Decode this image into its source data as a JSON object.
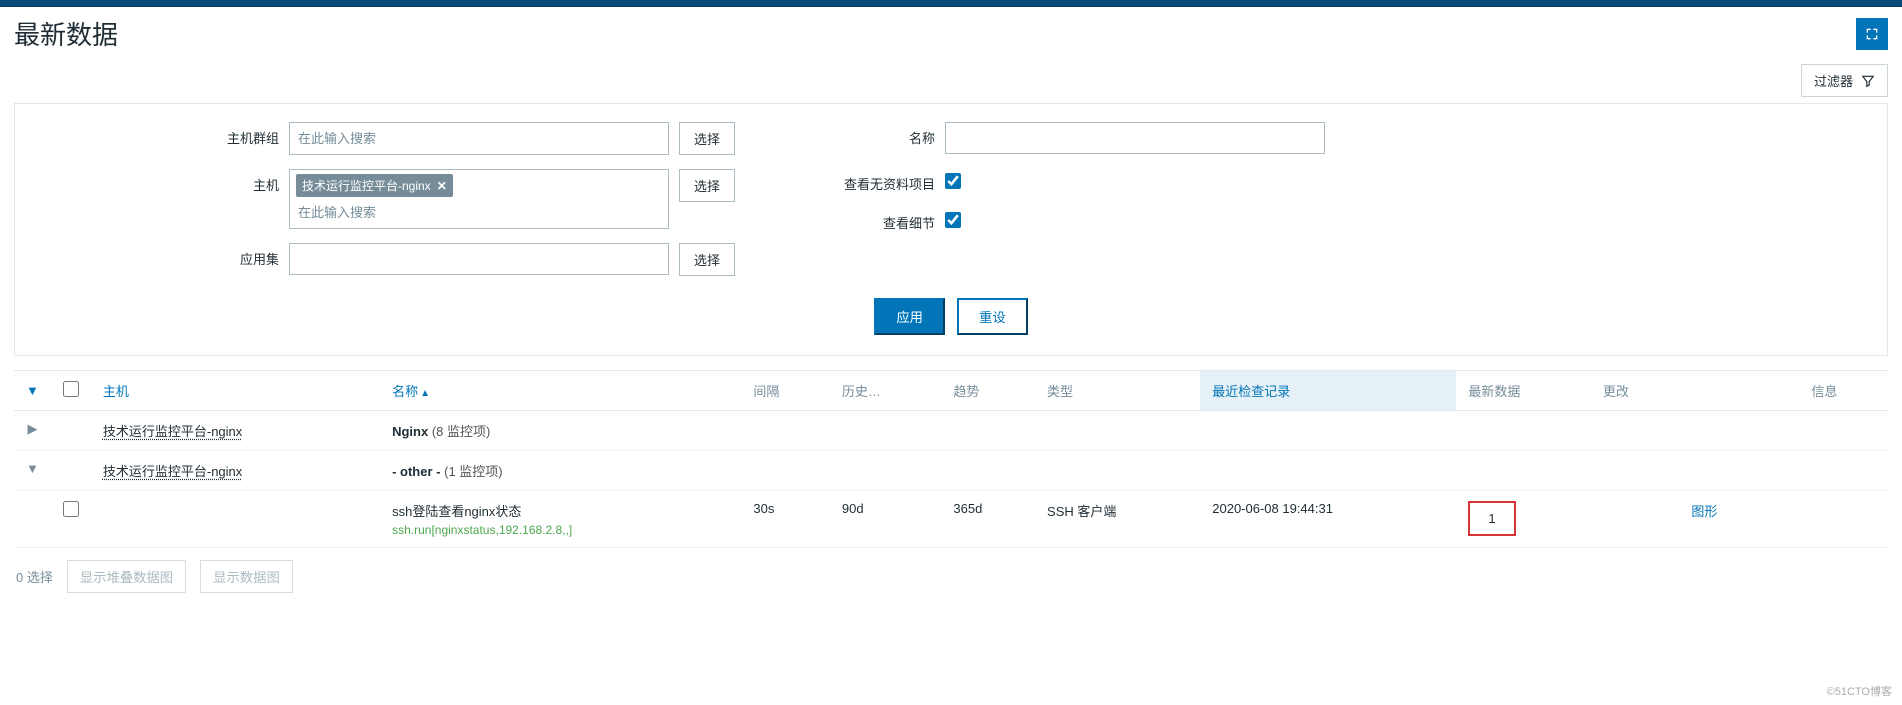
{
  "page": {
    "title": "最新数据"
  },
  "filter": {
    "toggle_label": "过滤器",
    "labels": {
      "host_group": "主机群组",
      "host": "主机",
      "app": "应用集",
      "name": "名称",
      "show_no_data": "查看无资料项目",
      "show_details": "查看细节"
    },
    "placeholders": {
      "search": "在此输入搜索"
    },
    "host_tag": "技术运行监控平台-nginx",
    "name_value": "",
    "app_value": "",
    "show_no_data": true,
    "show_details": true,
    "btn_select": "选择",
    "btn_apply": "应用",
    "btn_reset": "重设"
  },
  "table": {
    "headers": {
      "host": "主机",
      "name": "名称",
      "interval": "间隔",
      "history": "历史…",
      "trend": "趋势",
      "type": "类型",
      "last_check": "最近检查记录",
      "last_value": "最新数据",
      "change": "更改",
      "info": "信息"
    },
    "groups": [
      {
        "expanded": false,
        "host": "技术运行监控平台-nginx",
        "name": "Nginx",
        "count_label": "(8 监控项)"
      },
      {
        "expanded": true,
        "host": "技术运行监控平台-nginx",
        "name": "- other -",
        "count_label": "(1 监控项)",
        "items": [
          {
            "name": "ssh登陆查看nginx状态",
            "key": "ssh.run[nginxstatus,192.168.2.8,,]",
            "interval": "30s",
            "history": "90d",
            "trend": "365d",
            "type": "SSH 客户端",
            "last_check": "2020-06-08 19:44:31",
            "last_value": "1",
            "change": "",
            "graph": "图形"
          }
        ]
      }
    ]
  },
  "footer": {
    "selected": "0 选择",
    "btn_stacked": "显示堆叠数据图",
    "btn_graph": "显示数据图"
  },
  "watermark": "©51CTO博客"
}
